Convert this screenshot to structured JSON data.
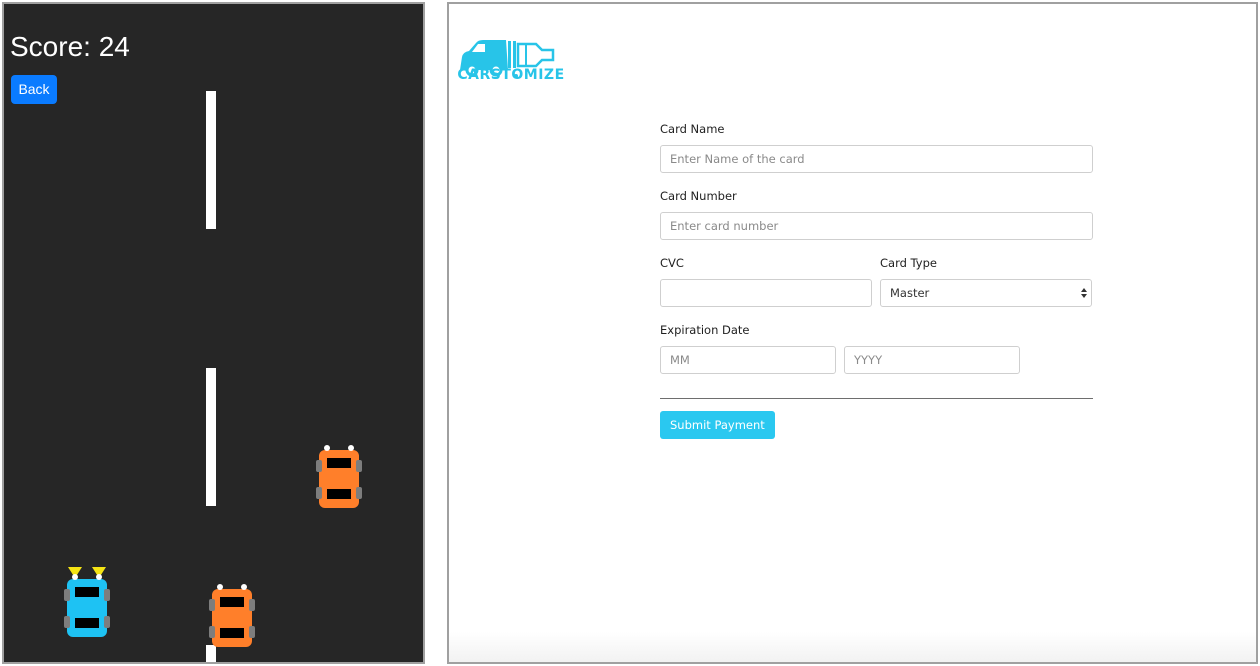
{
  "game": {
    "score_text": "Score: 24",
    "back_label": "Back",
    "colors": {
      "road": "#262626",
      "lane_line": "#ffffff",
      "enemy_car": "#ff7f2a",
      "player_car": "#1ec2f3",
      "headlight": "#f5e414",
      "back_button": "#0a7bff"
    }
  },
  "payment": {
    "logo_text": "CARSTOMIZE",
    "brand_color": "#28c4e8",
    "card_name": {
      "label": "Card Name",
      "placeholder": "Enter Name of the card",
      "value": ""
    },
    "card_number": {
      "label": "Card Number",
      "placeholder": "Enter card number",
      "value": ""
    },
    "cvc": {
      "label": "CVC",
      "value": ""
    },
    "card_type": {
      "label": "Card Type",
      "selected": "Master"
    },
    "expiration": {
      "label": "Expiration Date",
      "month_placeholder": "MM",
      "year_placeholder": "YYYY"
    },
    "submit_label": "Submit Payment",
    "submit_color": "#2ac8f0"
  }
}
